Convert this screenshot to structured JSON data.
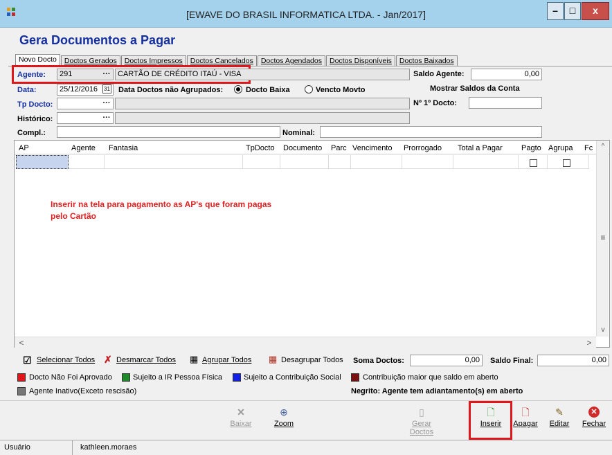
{
  "window": {
    "title": "[EWAVE DO BRASIL INFORMATICA LTDA. - Jan/2017]",
    "min": "–",
    "max": "□",
    "close": "x"
  },
  "header": {
    "title": "Gera Documentos a Pagar"
  },
  "tabs": [
    "Novo Docto",
    "Doctos Gerados",
    "Doctos Impressos",
    "Doctos Cancelados",
    "Doctos Agendados",
    "Doctos Disponíveis",
    "Doctos Baixados"
  ],
  "form": {
    "agente_label": "Agente:",
    "agente_code": "291",
    "agente_name": "CARTÃO DE CRÉDITO ITAÚ - VISA",
    "saldo_agente_label": "Saldo Agente:",
    "saldo_agente_value": "0,00",
    "data_label": "Data:",
    "data_value": "25/12/2016",
    "agrupados_label": "Data Doctos não Agrupados:",
    "radio1": "Docto Baixa",
    "radio2": "Vencto Movto",
    "mostrar_saldos": "Mostrar Saldos da Conta",
    "tpdocto_label": "Tp Docto:",
    "primeiro_docto_label": "Nº  1º Docto:",
    "historico_label": "Histórico:",
    "compl_label": "Compl.:",
    "nominal_label": "Nominal:",
    "ellipsis": "···",
    "calendar": "31"
  },
  "grid": {
    "columns": [
      "AP",
      "Agente",
      "Fantasia",
      "TpDocto",
      "Documento",
      "Parc",
      "Vencimento",
      "Prorrogado",
      "Total a Pagar",
      "Pagto",
      "Agrupa",
      "Fc"
    ],
    "annotation": "Inserir na tela para pagamento as AP's que foram pagas pelo Cartão",
    "scroll_up": "^",
    "scroll_down": "v",
    "scroll_left": "<",
    "scroll_right": ">",
    "scroll_grip": "≡"
  },
  "actions": {
    "selecionar": "Selecionar Todos",
    "desmarcar": "Desmarcar Todos",
    "agrupar": "Agrupar Todos",
    "desagrupar": "Desagrupar Todos",
    "soma_label": "Soma Doctos:",
    "soma_value": "0,00",
    "saldo_final_label": "Saldo Final:",
    "saldo_final_value": "0,00"
  },
  "legend": {
    "nao_aprovado": "Docto Não Foi Aprovado",
    "ir_pf": "Sujeito a IR Pessoa Física",
    "contrib_social": "Sujeito a Contribuição Social",
    "contrib_maior": "Contribuição maior que saldo em aberto",
    "inativo": "Agente Inativo(Exceto rescisão)",
    "negrito": "Negrito: Agente tem adiantamento(s) em aberto"
  },
  "toolbar": {
    "baixar": "Baixar",
    "zoom": "Zoom",
    "gerar": "Gerar Doctos",
    "inserir": "Inserir",
    "apagar": "Apagar",
    "editar": "Editar",
    "fechar": "Fechar"
  },
  "status": {
    "label": "Usuário",
    "user": "kathleen.moraes"
  },
  "colors": {
    "red": "#e0161b",
    "green": "#1f8a2a",
    "blue": "#1020e8",
    "darkred": "#7a1010",
    "gray": "#777777"
  }
}
